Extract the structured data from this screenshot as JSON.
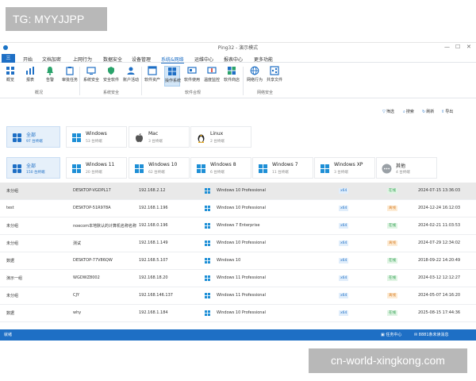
{
  "watermark_tag": "TG: MYYJJPP",
  "watermark_site": "cn-world-xingkong.com",
  "window": {
    "title": "Ping32 - 演示模式"
  },
  "menu": [
    "三",
    "开始",
    "文档加密",
    "上网行为",
    "数据安全",
    "设备管理",
    "系统&网络",
    "运维中心",
    "报表中心",
    "更多功能"
  ],
  "ribbon": {
    "buttons": [
      "概览",
      "报表",
      "告警",
      "审批任务",
      "系统安全",
      "安全软件",
      "账户活动",
      "软件资产",
      "操作系统",
      "软件使用",
      "温度监控",
      "软件商店",
      "网络行为",
      "共享文件"
    ],
    "groups": [
      "概况",
      "系统安全",
      "软件合规",
      "网络安全"
    ]
  },
  "actions": [
    "筛选",
    "搜索",
    "刷新",
    "导出"
  ],
  "os_cards_row1": [
    {
      "name": "全部",
      "count": "97 台终端"
    },
    {
      "name": "Windows",
      "count": "53 台终端"
    },
    {
      "name": "Mac",
      "count": "3 台终端"
    },
    {
      "name": "Linux",
      "count": "2 台终端"
    }
  ],
  "os_cards_row2": [
    {
      "name": "全部",
      "count": "150 台终端"
    },
    {
      "name": "Windows 11",
      "count": "20 台终端"
    },
    {
      "name": "Windows 10",
      "count": "62 台终端"
    },
    {
      "name": "Windows 8",
      "count": "6 台终端"
    },
    {
      "name": "Windows 7",
      "count": "11 台终端"
    },
    {
      "name": "Windows XP",
      "count": "3 台终端"
    },
    {
      "name": "其他",
      "count": "4 台终端"
    }
  ],
  "rows": [
    {
      "group": "未分组",
      "host": "DESKTOP-VGDPL17",
      "ip": "192.168.2.12",
      "os": "Windows 10 Professional",
      "arch": "x64",
      "status": "在线",
      "time": "2024-07-15 13:36:03"
    },
    {
      "group": "test",
      "host": "DESKTOP-51R978A",
      "ip": "192.168.1.196",
      "os": "Windows 10 Professional",
      "arch": "x64",
      "status": "离线",
      "time": "2024-12-24 16:12:03"
    },
    {
      "group": "未分组",
      "host": "noecom本地默认的计算机名称名称",
      "ip": "192.168.0.196",
      "os": "Windows 7 Enterprise",
      "arch": "x64",
      "status": "在线",
      "time": "2024-02-21 11:03:53"
    },
    {
      "group": "未分组",
      "host": "测试",
      "ip": "192.168.1.149",
      "os": "Windows 10 Professional",
      "arch": "x64",
      "status": "离线",
      "time": "2024-07-29 12:34:02"
    },
    {
      "group": "数据",
      "host": "DESKTOP-77V86QW",
      "ip": "192.168.5.107",
      "os": "Windows 10",
      "arch": "x64",
      "status": "在线",
      "time": "2018-09-22 14:20:49"
    },
    {
      "group": "演示一组",
      "host": "WGDWZ8002",
      "ip": "192.168.18.20",
      "os": "Windows 11 Professional",
      "arch": "x64",
      "status": "在线",
      "time": "2024-03-12 12:12:27"
    },
    {
      "group": "未分组",
      "host": "CJY",
      "ip": "192.168.146.137",
      "os": "Windows 11 Professional",
      "arch": "x64",
      "status": "离线",
      "time": "2024-05-07 14:16:20"
    },
    {
      "group": "数据",
      "host": "why",
      "ip": "192.168.1.184",
      "os": "Windows 10 Professional",
      "arch": "x64",
      "status": "在线",
      "time": "2025-08-15 17:44:36"
    }
  ],
  "statusbar": {
    "left": "就绪",
    "task": "任务中心",
    "right": "8881条未读消息"
  },
  "colors": {
    "accent": "#1e6fc5",
    "online": "#2a9d4b",
    "offline": "#d9822b"
  }
}
